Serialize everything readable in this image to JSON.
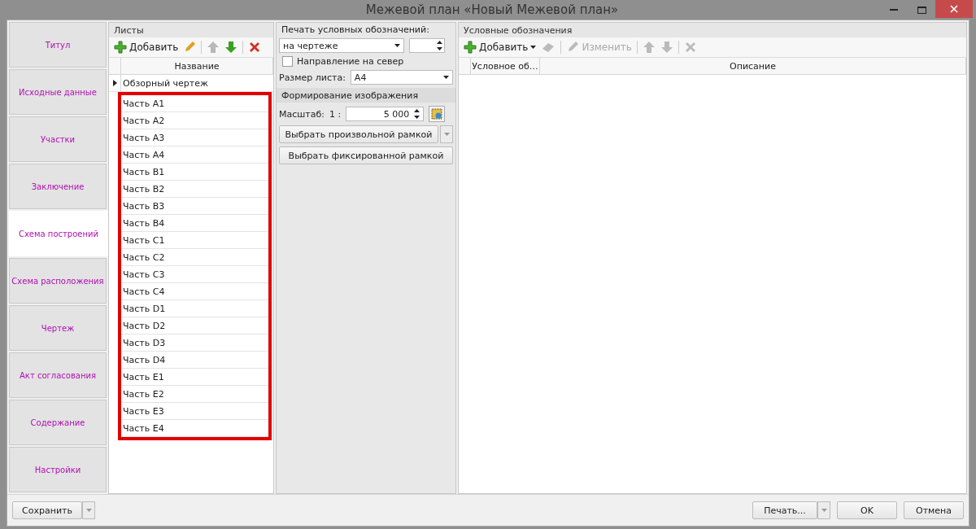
{
  "window": {
    "title": "Межевой план «Новый Межевой план»"
  },
  "nav": [
    {
      "label": "Титул",
      "selected": false
    },
    {
      "label": "Исходные данные",
      "selected": false
    },
    {
      "label": "Участки",
      "selected": false
    },
    {
      "label": "Заключение",
      "selected": false
    },
    {
      "label": "Схема построений",
      "selected": true
    },
    {
      "label": "Схема расположения",
      "selected": false
    },
    {
      "label": "Чертеж",
      "selected": false
    },
    {
      "label": "Акт согласования",
      "selected": false
    },
    {
      "label": "Содержание",
      "selected": false
    },
    {
      "label": "Настройки",
      "selected": false
    }
  ],
  "sheets": {
    "title": "Листы",
    "add_label": "Добавить",
    "column": "Название",
    "rows": [
      {
        "name": "Обзорный чертеж",
        "current": true,
        "framed": false
      },
      {
        "name": "Часть A1",
        "current": false,
        "framed": true
      },
      {
        "name": "Часть A2",
        "current": false,
        "framed": true
      },
      {
        "name": "Часть A3",
        "current": false,
        "framed": true
      },
      {
        "name": "Часть A4",
        "current": false,
        "framed": true
      },
      {
        "name": "Часть B1",
        "current": false,
        "framed": true
      },
      {
        "name": "Часть B2",
        "current": false,
        "framed": true
      },
      {
        "name": "Часть B3",
        "current": false,
        "framed": true
      },
      {
        "name": "Часть B4",
        "current": false,
        "framed": true
      },
      {
        "name": "Часть C1",
        "current": false,
        "framed": true
      },
      {
        "name": "Часть C2",
        "current": false,
        "framed": true
      },
      {
        "name": "Часть C3",
        "current": false,
        "framed": true
      },
      {
        "name": "Часть C4",
        "current": false,
        "framed": true
      },
      {
        "name": "Часть D1",
        "current": false,
        "framed": true
      },
      {
        "name": "Часть D2",
        "current": false,
        "framed": true
      },
      {
        "name": "Часть D3",
        "current": false,
        "framed": true
      },
      {
        "name": "Часть D4",
        "current": false,
        "framed": true
      },
      {
        "name": "Часть E1",
        "current": false,
        "framed": true
      },
      {
        "name": "Часть E2",
        "current": false,
        "framed": true
      },
      {
        "name": "Часть E3",
        "current": false,
        "framed": true
      },
      {
        "name": "Часть E4",
        "current": false,
        "framed": true
      }
    ]
  },
  "settings": {
    "print_legend_label": "Печать условных обозначений:",
    "print_legend_value": "на чертеже",
    "north": {
      "label": "Направление на север",
      "checked": false
    },
    "sheet_size_label": "Размер листа:",
    "sheet_size_value": "А4",
    "image_section": "Формирование изображения",
    "scale_label": "Масштаб:",
    "scale_prefix": "1 :",
    "scale_value": "5 000",
    "free_frame_button": "Выбрать произвольной рамкой",
    "fixed_frame_button": "Выбрать фиксированной рамкой"
  },
  "legend": {
    "title": "Условные обозначения",
    "add_label": "Добавить",
    "edit_label": "Изменить",
    "columns": [
      "Условное об…",
      "Описание"
    ]
  },
  "footer": {
    "save": "Сохранить",
    "print": "Печать...",
    "ok": "OK",
    "cancel": "Отмена"
  }
}
